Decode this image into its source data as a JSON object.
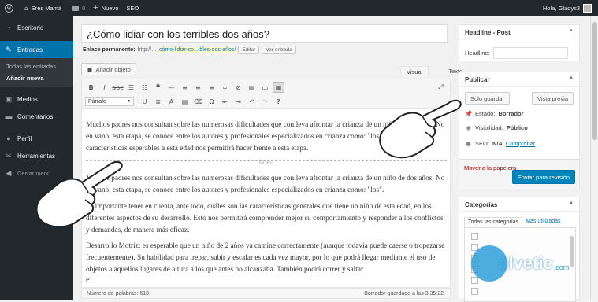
{
  "admin_bar": {
    "site_name": "Eres Mamá",
    "comments_count": "0",
    "new_label": "Nuevo",
    "seo_label": "SEO",
    "greeting": "Hola, Gladys3"
  },
  "sidebar": {
    "items": [
      {
        "label": "Escritorio",
        "icon": "dashboard-icon"
      },
      {
        "label": "Entradas",
        "icon": "pin-icon"
      },
      {
        "label": "Medios",
        "icon": "media-icon"
      },
      {
        "label": "Comentarios",
        "icon": "comments-icon"
      },
      {
        "label": "Perfil",
        "icon": "user-icon"
      },
      {
        "label": "Herramientas",
        "icon": "tools-icon"
      },
      {
        "label": "Cerrar menú",
        "icon": "collapse-icon"
      }
    ],
    "submenu": [
      "Todas las entradas",
      "Añadir nueva"
    ]
  },
  "post": {
    "title": "¿Cómo lidiar con los terribles dos años?",
    "permalink_label": "Enlace permanente:",
    "permalink_base": "http://…",
    "permalink_slug": "cómo-lidiar-co...ibles-dos-años/",
    "edit_label": "Editar",
    "view_label": "Ver entrada"
  },
  "editor": {
    "add_media": "Añadir objeto",
    "tab_visual": "Visual",
    "tab_text": "Texto",
    "format_select": "Párrafo",
    "more_label": "MORE",
    "paragraphs": [
      "Muchos padres nos consultan sobre las numerosas dificultades que conlleva afrontar la crianza de un niño de dos años. No en vano, esta etapa, se conoce entre los autores y profesionales especializados en crianza como: \"los\". Conocer las características esperables a esta edad nos permitirá hacer frente a esta etapa.",
      "Muchos padres nos consultan sobre las numerosas dificultades que conlleva afrontar la crianza de un niño de dos años. No en vano, esta etapa, se conoce entre los autores y profesionales especializados en crianza como: \"los\".",
      "Es importante tener en cuenta, ante todo, cuáles son las características generales que tiene un niño de esta edad, en los diferentes aspectos de su desarrollo. Esto nos permitirá comprender mejor su comportamiento y responder a los conflictos y demandas, de manera más eficaz.",
      "Desarrollo Motriz: es esperable que un niño de 2 años ya camine correctamente (aunque todavía puede caerse o tropezarse frecuentemente). Su habilidad para trepar, subir y escalar es cada vez mayor, por lo que podrá llegar mediante el uso de objetos a aquellos lugares de altura a los que antes no alcanzaba. También podrá correr y saltar"
    ],
    "path": "P",
    "word_count": "Número de palabras: 618",
    "draft_saved": "Borrador guardado a las 3:35:22."
  },
  "headline_box": {
    "title": "Headline - Post",
    "field_label": "Headline:",
    "field_value": ""
  },
  "publish_box": {
    "title": "Publicar",
    "save_label": "Solo guardar",
    "preview_label": "Vista previa",
    "status_label": "Estado:",
    "status_value": "Borrador",
    "visibility_label": "Visibilidad:",
    "visibility_value": "Público",
    "seo_label": "SEO:",
    "seo_value": "N/A",
    "seo_link": "Comprobar",
    "trash_label": "Mover a la papelera",
    "submit_label": "Enviar para revisión"
  },
  "categories_box": {
    "title": "Categorías",
    "tab_all": "Todas las categorías",
    "tab_used": "Más utilizadas"
  },
  "watermark": {
    "text": "olvetic",
    "suffix": ".com"
  },
  "colors": {
    "admin_dark": "#23282d",
    "accent_blue": "#0073aa",
    "primary_button": "#0085ba",
    "trash_red": "#a00"
  }
}
